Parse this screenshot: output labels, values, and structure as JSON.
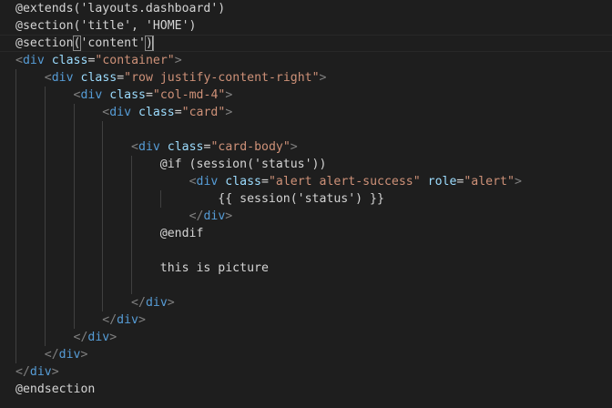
{
  "colors": {
    "background": "#1e1e1e",
    "plain": "#d4d4d4",
    "tag_bracket": "#808080",
    "tag_name": "#569cd6",
    "attribute": "#9cdcfe",
    "string": "#ce9178",
    "indent_guide": "#404040"
  },
  "editor": {
    "lines": [
      [
        {
          "t": "plain",
          "v": "@extends('layouts.dashboard')"
        }
      ],
      [
        {
          "t": "plain",
          "v": "@section('title', 'HOME')"
        }
      ],
      [
        {
          "t": "plain",
          "v": "@section"
        },
        {
          "t": "plain",
          "v": "(",
          "bm": true
        },
        {
          "t": "plain",
          "v": "'content'"
        },
        {
          "t": "plain",
          "v": ")",
          "bm": true
        },
        {
          "t": "cursor",
          "v": ""
        }
      ],
      [
        {
          "t": "bracket",
          "v": "<"
        },
        {
          "t": "tag",
          "v": "div"
        },
        {
          "t": "plain",
          "v": " "
        },
        {
          "t": "attr",
          "v": "class"
        },
        {
          "t": "plain",
          "v": "="
        },
        {
          "t": "string",
          "v": "\"container\""
        },
        {
          "t": "bracket",
          "v": ">"
        }
      ],
      [
        {
          "t": "plain",
          "v": "    "
        },
        {
          "t": "bracket",
          "v": "<"
        },
        {
          "t": "tag",
          "v": "div"
        },
        {
          "t": "plain",
          "v": " "
        },
        {
          "t": "attr",
          "v": "class"
        },
        {
          "t": "plain",
          "v": "="
        },
        {
          "t": "string",
          "v": "\"row justify-content-right\""
        },
        {
          "t": "bracket",
          "v": ">"
        }
      ],
      [
        {
          "t": "plain",
          "v": "        "
        },
        {
          "t": "bracket",
          "v": "<"
        },
        {
          "t": "tag",
          "v": "div"
        },
        {
          "t": "plain",
          "v": " "
        },
        {
          "t": "attr",
          "v": "class"
        },
        {
          "t": "plain",
          "v": "="
        },
        {
          "t": "string",
          "v": "\"col-md-4\""
        },
        {
          "t": "bracket",
          "v": ">"
        }
      ],
      [
        {
          "t": "plain",
          "v": "            "
        },
        {
          "t": "bracket",
          "v": "<"
        },
        {
          "t": "tag",
          "v": "div"
        },
        {
          "t": "plain",
          "v": " "
        },
        {
          "t": "attr",
          "v": "class"
        },
        {
          "t": "plain",
          "v": "="
        },
        {
          "t": "string",
          "v": "\"card\""
        },
        {
          "t": "bracket",
          "v": ">"
        }
      ],
      [],
      [
        {
          "t": "plain",
          "v": "                "
        },
        {
          "t": "bracket",
          "v": "<"
        },
        {
          "t": "tag",
          "v": "div"
        },
        {
          "t": "plain",
          "v": " "
        },
        {
          "t": "attr",
          "v": "class"
        },
        {
          "t": "plain",
          "v": "="
        },
        {
          "t": "string",
          "v": "\"card-body\""
        },
        {
          "t": "bracket",
          "v": ">"
        }
      ],
      [
        {
          "t": "plain",
          "v": "                    @if (session('status'))"
        }
      ],
      [
        {
          "t": "plain",
          "v": "                        "
        },
        {
          "t": "bracket",
          "v": "<"
        },
        {
          "t": "tag",
          "v": "div"
        },
        {
          "t": "plain",
          "v": " "
        },
        {
          "t": "attr",
          "v": "class"
        },
        {
          "t": "plain",
          "v": "="
        },
        {
          "t": "string",
          "v": "\"alert alert-success\""
        },
        {
          "t": "plain",
          "v": " "
        },
        {
          "t": "attr",
          "v": "role"
        },
        {
          "t": "plain",
          "v": "="
        },
        {
          "t": "string",
          "v": "\"alert\""
        },
        {
          "t": "bracket",
          "v": ">"
        }
      ],
      [
        {
          "t": "plain",
          "v": "                            {{ session('status') }}"
        }
      ],
      [
        {
          "t": "plain",
          "v": "                        "
        },
        {
          "t": "bracket",
          "v": "</"
        },
        {
          "t": "tag",
          "v": "div"
        },
        {
          "t": "bracket",
          "v": ">"
        }
      ],
      [
        {
          "t": "plain",
          "v": "                    @endif"
        }
      ],
      [],
      [
        {
          "t": "plain",
          "v": "                    this is picture"
        }
      ],
      [],
      [
        {
          "t": "plain",
          "v": "                "
        },
        {
          "t": "bracket",
          "v": "</"
        },
        {
          "t": "tag",
          "v": "div"
        },
        {
          "t": "bracket",
          "v": ">"
        }
      ],
      [
        {
          "t": "plain",
          "v": "            "
        },
        {
          "t": "bracket",
          "v": "</"
        },
        {
          "t": "tag",
          "v": "div"
        },
        {
          "t": "bracket",
          "v": ">"
        }
      ],
      [
        {
          "t": "plain",
          "v": "        "
        },
        {
          "t": "bracket",
          "v": "</"
        },
        {
          "t": "tag",
          "v": "div"
        },
        {
          "t": "bracket",
          "v": ">"
        }
      ],
      [
        {
          "t": "plain",
          "v": "    "
        },
        {
          "t": "bracket",
          "v": "</"
        },
        {
          "t": "tag",
          "v": "div"
        },
        {
          "t": "bracket",
          "v": ">"
        }
      ],
      [
        {
          "t": "bracket",
          "v": "</"
        },
        {
          "t": "tag",
          "v": "div"
        },
        {
          "t": "bracket",
          "v": ">"
        }
      ],
      [
        {
          "t": "plain",
          "v": "@endsection"
        }
      ]
    ]
  }
}
